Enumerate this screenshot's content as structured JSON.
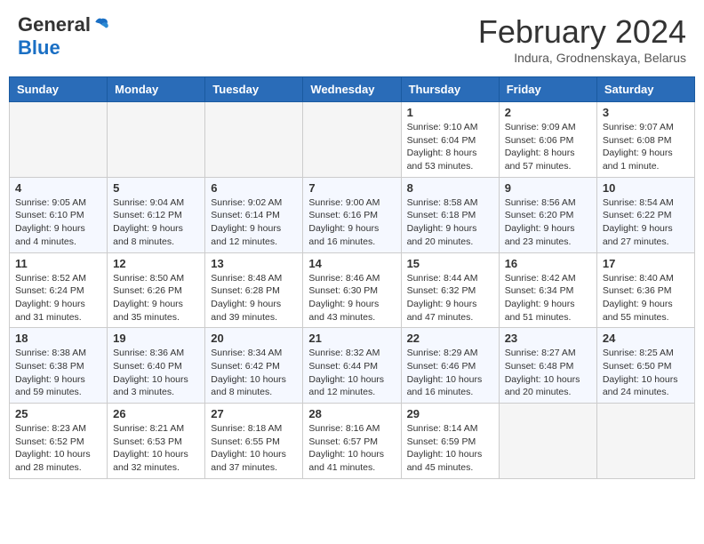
{
  "header": {
    "logo_general": "General",
    "logo_blue": "Blue",
    "calendar_title": "February 2024",
    "calendar_subtitle": "Indura, Grodnenskaya, Belarus"
  },
  "days_of_week": [
    "Sunday",
    "Monday",
    "Tuesday",
    "Wednesday",
    "Thursday",
    "Friday",
    "Saturday"
  ],
  "weeks": [
    [
      {
        "day": "",
        "info": ""
      },
      {
        "day": "",
        "info": ""
      },
      {
        "day": "",
        "info": ""
      },
      {
        "day": "",
        "info": ""
      },
      {
        "day": "1",
        "info": "Sunrise: 9:10 AM\nSunset: 6:04 PM\nDaylight: 8 hours\nand 53 minutes."
      },
      {
        "day": "2",
        "info": "Sunrise: 9:09 AM\nSunset: 6:06 PM\nDaylight: 8 hours\nand 57 minutes."
      },
      {
        "day": "3",
        "info": "Sunrise: 9:07 AM\nSunset: 6:08 PM\nDaylight: 9 hours\nand 1 minute."
      }
    ],
    [
      {
        "day": "4",
        "info": "Sunrise: 9:05 AM\nSunset: 6:10 PM\nDaylight: 9 hours\nand 4 minutes."
      },
      {
        "day": "5",
        "info": "Sunrise: 9:04 AM\nSunset: 6:12 PM\nDaylight: 9 hours\nand 8 minutes."
      },
      {
        "day": "6",
        "info": "Sunrise: 9:02 AM\nSunset: 6:14 PM\nDaylight: 9 hours\nand 12 minutes."
      },
      {
        "day": "7",
        "info": "Sunrise: 9:00 AM\nSunset: 6:16 PM\nDaylight: 9 hours\nand 16 minutes."
      },
      {
        "day": "8",
        "info": "Sunrise: 8:58 AM\nSunset: 6:18 PM\nDaylight: 9 hours\nand 20 minutes."
      },
      {
        "day": "9",
        "info": "Sunrise: 8:56 AM\nSunset: 6:20 PM\nDaylight: 9 hours\nand 23 minutes."
      },
      {
        "day": "10",
        "info": "Sunrise: 8:54 AM\nSunset: 6:22 PM\nDaylight: 9 hours\nand 27 minutes."
      }
    ],
    [
      {
        "day": "11",
        "info": "Sunrise: 8:52 AM\nSunset: 6:24 PM\nDaylight: 9 hours\nand 31 minutes."
      },
      {
        "day": "12",
        "info": "Sunrise: 8:50 AM\nSunset: 6:26 PM\nDaylight: 9 hours\nand 35 minutes."
      },
      {
        "day": "13",
        "info": "Sunrise: 8:48 AM\nSunset: 6:28 PM\nDaylight: 9 hours\nand 39 minutes."
      },
      {
        "day": "14",
        "info": "Sunrise: 8:46 AM\nSunset: 6:30 PM\nDaylight: 9 hours\nand 43 minutes."
      },
      {
        "day": "15",
        "info": "Sunrise: 8:44 AM\nSunset: 6:32 PM\nDaylight: 9 hours\nand 47 minutes."
      },
      {
        "day": "16",
        "info": "Sunrise: 8:42 AM\nSunset: 6:34 PM\nDaylight: 9 hours\nand 51 minutes."
      },
      {
        "day": "17",
        "info": "Sunrise: 8:40 AM\nSunset: 6:36 PM\nDaylight: 9 hours\nand 55 minutes."
      }
    ],
    [
      {
        "day": "18",
        "info": "Sunrise: 8:38 AM\nSunset: 6:38 PM\nDaylight: 9 hours\nand 59 minutes."
      },
      {
        "day": "19",
        "info": "Sunrise: 8:36 AM\nSunset: 6:40 PM\nDaylight: 10 hours\nand 3 minutes."
      },
      {
        "day": "20",
        "info": "Sunrise: 8:34 AM\nSunset: 6:42 PM\nDaylight: 10 hours\nand 8 minutes."
      },
      {
        "day": "21",
        "info": "Sunrise: 8:32 AM\nSunset: 6:44 PM\nDaylight: 10 hours\nand 12 minutes."
      },
      {
        "day": "22",
        "info": "Sunrise: 8:29 AM\nSunset: 6:46 PM\nDaylight: 10 hours\nand 16 minutes."
      },
      {
        "day": "23",
        "info": "Sunrise: 8:27 AM\nSunset: 6:48 PM\nDaylight: 10 hours\nand 20 minutes."
      },
      {
        "day": "24",
        "info": "Sunrise: 8:25 AM\nSunset: 6:50 PM\nDaylight: 10 hours\nand 24 minutes."
      }
    ],
    [
      {
        "day": "25",
        "info": "Sunrise: 8:23 AM\nSunset: 6:52 PM\nDaylight: 10 hours\nand 28 minutes."
      },
      {
        "day": "26",
        "info": "Sunrise: 8:21 AM\nSunset: 6:53 PM\nDaylight: 10 hours\nand 32 minutes."
      },
      {
        "day": "27",
        "info": "Sunrise: 8:18 AM\nSunset: 6:55 PM\nDaylight: 10 hours\nand 37 minutes."
      },
      {
        "day": "28",
        "info": "Sunrise: 8:16 AM\nSunset: 6:57 PM\nDaylight: 10 hours\nand 41 minutes."
      },
      {
        "day": "29",
        "info": "Sunrise: 8:14 AM\nSunset: 6:59 PM\nDaylight: 10 hours\nand 45 minutes."
      },
      {
        "day": "",
        "info": ""
      },
      {
        "day": "",
        "info": ""
      }
    ]
  ]
}
